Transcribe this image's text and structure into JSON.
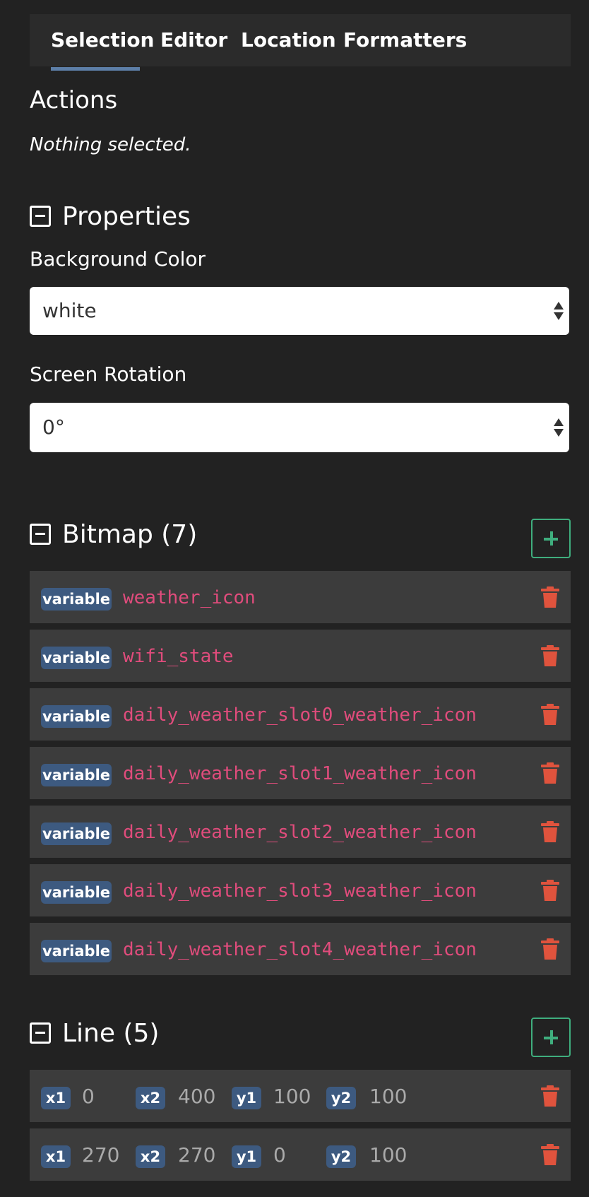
{
  "tabs": [
    {
      "label": "Selection",
      "active": true
    },
    {
      "label": "Editor",
      "active": false
    },
    {
      "label": "Location",
      "active": false
    },
    {
      "label": "Formatters",
      "active": false
    }
  ],
  "actions": {
    "title": "Actions",
    "empty_text": "Nothing selected."
  },
  "properties": {
    "title": "Properties",
    "background_color": {
      "label": "Background Color",
      "value": "white"
    },
    "screen_rotation": {
      "label": "Screen Rotation",
      "value": "0°"
    }
  },
  "bitmap": {
    "title": "Bitmap (7)",
    "items": [
      {
        "badge": "variable",
        "name": "weather_icon"
      },
      {
        "badge": "variable",
        "name": "wifi_state"
      },
      {
        "badge": "variable",
        "name": "daily_weather_slot0_weather_icon"
      },
      {
        "badge": "variable",
        "name": "daily_weather_slot1_weather_icon"
      },
      {
        "badge": "variable",
        "name": "daily_weather_slot2_weather_icon"
      },
      {
        "badge": "variable",
        "name": "daily_weather_slot3_weather_icon"
      },
      {
        "badge": "variable",
        "name": "daily_weather_slot4_weather_icon"
      }
    ]
  },
  "line": {
    "title": "Line (5)",
    "labels": {
      "x1": "x1",
      "x2": "x2",
      "y1": "y1",
      "y2": "y2"
    },
    "items": [
      {
        "x1": "0",
        "x2": "400",
        "y1": "100",
        "y2": "100"
      },
      {
        "x1": "270",
        "x2": "270",
        "y1": "0",
        "y2": "100"
      }
    ]
  },
  "colors": {
    "background": "#222222",
    "row": "#3c3c3c",
    "badge": "#3d5a80",
    "variable_text": "#e04c7c",
    "add_button": "#3fae7e",
    "delete_icon": "#e0533d"
  },
  "icons": {
    "collapse": "minus-square-icon",
    "add": "plus-icon",
    "delete": "trash-icon"
  }
}
